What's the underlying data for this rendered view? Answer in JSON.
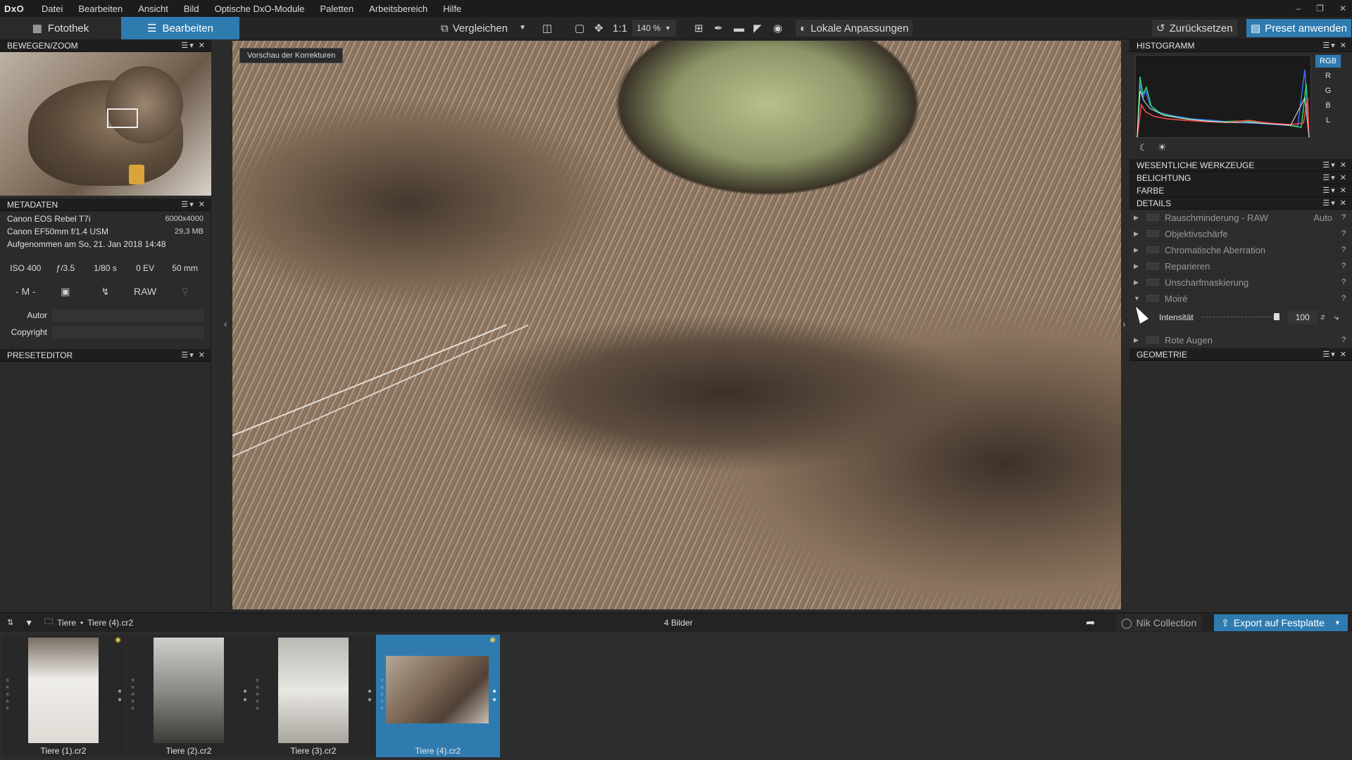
{
  "menubar": {
    "logo": "DxO",
    "items": [
      "Datei",
      "Bearbeiten",
      "Ansicht",
      "Bild",
      "Optische DxO-Module",
      "Paletten",
      "Arbeitsbereich",
      "Hilfe"
    ]
  },
  "toolbar": {
    "tab_library": "Fotothek",
    "tab_edit": "Bearbeiten",
    "compare": "Vergleichen",
    "zoom_1to1": "1:1",
    "zoom_level": "140 %",
    "local_adjust": "Lokale Anpassungen",
    "reset": "Zurücksetzen",
    "apply_preset": "Preset anwenden"
  },
  "left": {
    "move_zoom_title": "BEWEGEN/ZOOM",
    "metadata_title": "METADATEN",
    "camera": "Canon EOS Rebel T7i",
    "resolution": "6000x4000",
    "lens": "Canon EF50mm f/1.4 USM",
    "filesize": "29,3 MB",
    "captured": "Aufgenommen am So, 21. Jan 2018 14:48",
    "iso": "ISO 400",
    "aperture": "ƒ/3.5",
    "shutter": "1/80 s",
    "ev": "0 EV",
    "focal": "50 mm",
    "mode": "- M -",
    "raw": "RAW",
    "author_label": "Autor",
    "copyright_label": "Copyright",
    "preset_editor_title": "PRESETEDITOR"
  },
  "viewer": {
    "preview_label": "Vorschau der Korrekturen"
  },
  "right": {
    "histogram_title": "HISTOGRAMM",
    "channels": [
      "RGB",
      "R",
      "G",
      "B",
      "L"
    ],
    "essential_tools": "WESENTLICHE WERKZEUGE",
    "exposure": "BELICHTUNG",
    "color": "FARBE",
    "details": "DETAILS",
    "detail_items": [
      {
        "name": "Rauschminderung - RAW",
        "extra": "Auto"
      },
      {
        "name": "Objektivschärfe",
        "extra": ""
      },
      {
        "name": "Chromatische Aberration",
        "extra": ""
      },
      {
        "name": "Reparieren",
        "extra": ""
      },
      {
        "name": "Unscharfmaskierung",
        "extra": ""
      },
      {
        "name": "Moiré",
        "extra": ""
      }
    ],
    "moire_intensity_label": "Intensität",
    "moire_intensity_value": "100",
    "red_eye": "Rote Augen",
    "geometry": "GEOMETRIE"
  },
  "statusbar": {
    "breadcrumb_folder": "Tiere",
    "breadcrumb_file": "Tiere (4).cr2",
    "count": "4 Bilder",
    "nik": "Nik Collection",
    "export": "Export auf Festplatte"
  },
  "filmstrip": [
    {
      "label": "Tiere (1).cr2",
      "color": "#e8e6e2"
    },
    {
      "label": "Tiere (2).cr2",
      "color": "#5b5d58"
    },
    {
      "label": "Tiere (3).cr2",
      "color": "#cfcdc8"
    },
    {
      "label": "Tiere (4).cr2",
      "color": "#6d5d4d",
      "selected": true
    }
  ],
  "colors": {
    "accent": "#2f7bb0",
    "panel": "#2b2b2b",
    "header": "#1e1e1e"
  }
}
